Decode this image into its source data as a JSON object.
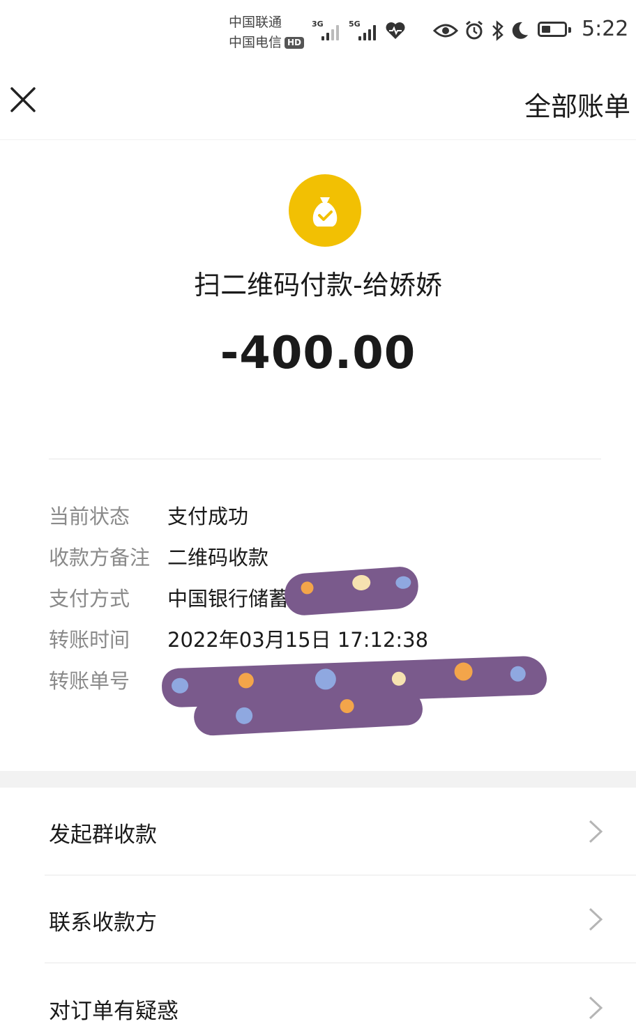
{
  "status_bar": {
    "carrier_1": "中国联通",
    "carrier_2": "中国电信",
    "hd_badge": "HD",
    "signal_1_tag": "3G",
    "signal_2_tag": "5G",
    "time": "5:22"
  },
  "navbar": {
    "all_bills_label": "全部账单"
  },
  "summary": {
    "title": "扫二维码付款-给娇娇",
    "amount": "-400.00",
    "icon_color": "#f2c003"
  },
  "details": [
    {
      "label": "当前状态",
      "value": "支付成功"
    },
    {
      "label": "收款方备注",
      "value": "二维码收款"
    },
    {
      "label": "支付方式",
      "value": "中国银行储蓄卡"
    },
    {
      "label": "转账时间",
      "value": "2022年03月15日 17:12:38"
    },
    {
      "label": "转账单号",
      "value": ""
    }
  ],
  "menu": [
    {
      "label": "发起群收款"
    },
    {
      "label": "联系收款方"
    },
    {
      "label": "对订单有疑惑"
    }
  ]
}
